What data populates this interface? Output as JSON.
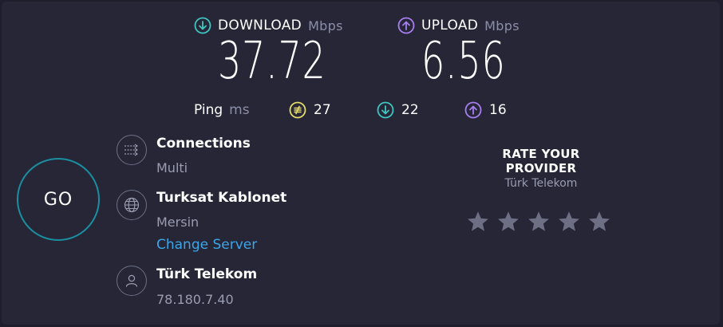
{
  "download": {
    "label": "DOWNLOAD",
    "unit": "Mbps",
    "value": "37.72"
  },
  "upload": {
    "label": "UPLOAD",
    "unit": "Mbps",
    "value": "6.56"
  },
  "ping": {
    "label": "Ping",
    "unit": "ms",
    "idle": "27",
    "download": "22",
    "upload": "16"
  },
  "go_label": "GO",
  "connections": {
    "title": "Connections",
    "value": "Multi"
  },
  "server": {
    "name": "Turksat Kablonet",
    "location": "Mersin",
    "change_label": "Change Server"
  },
  "provider": {
    "name": "Türk Telekom",
    "ip": "78.180.7.40"
  },
  "rate": {
    "title": "RATE YOUR PROVIDER",
    "provider": "Türk Telekom",
    "stars_total": 5,
    "stars_selected": 0
  },
  "colors": {
    "background": "#262637",
    "download_accent": "#3ec6c0",
    "upload_accent": "#a77ff1",
    "idle_ping_accent": "#e5dc6a",
    "go_ring": "#1a8fa0",
    "link": "#3ba6e8",
    "star": "#6d6f84"
  },
  "icons": {
    "download": "download-arrow-icon",
    "upload": "upload-arrow-icon",
    "idle": "idle-ping-icon",
    "connections": "connections-icon",
    "server": "globe-icon",
    "provider": "user-icon",
    "star": "star-icon"
  }
}
